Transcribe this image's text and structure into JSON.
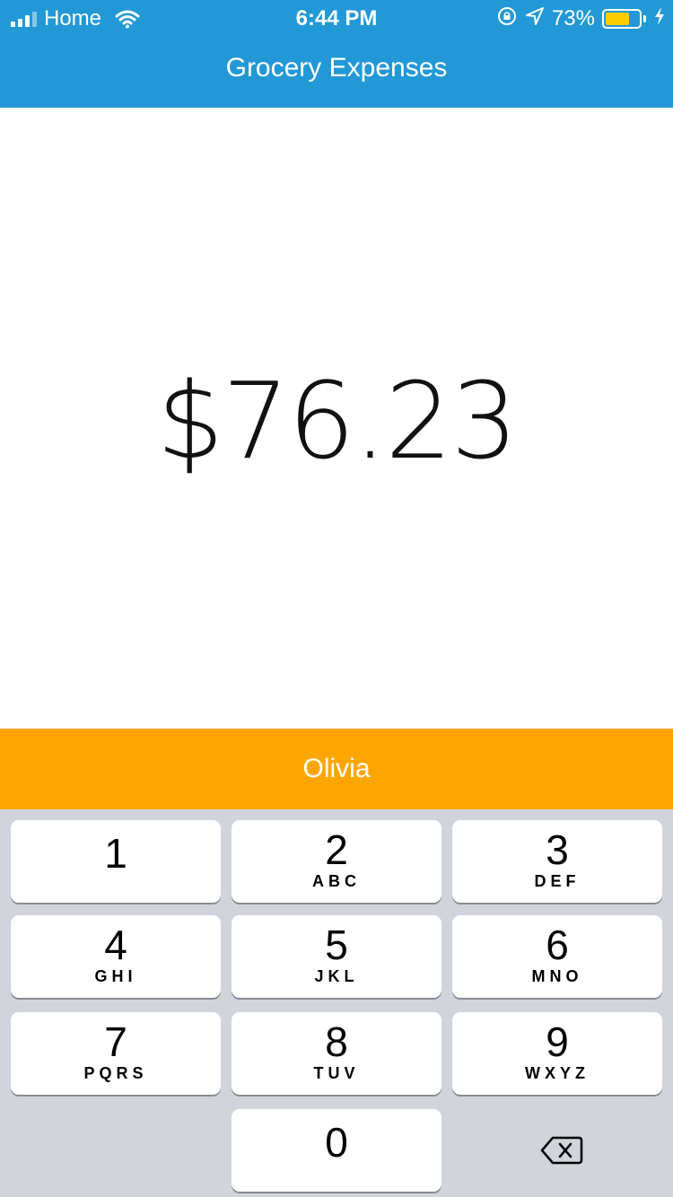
{
  "status_bar": {
    "carrier": "Home",
    "time": "6:44 PM",
    "battery_percent": "73%",
    "battery_level": 0.73
  },
  "nav": {
    "title": "Grocery Expenses"
  },
  "amount": "$76.23",
  "person": "Olivia",
  "keypad": {
    "keys": [
      {
        "digit": "1",
        "letters": ""
      },
      {
        "digit": "2",
        "letters": "ABC"
      },
      {
        "digit": "3",
        "letters": "DEF"
      },
      {
        "digit": "4",
        "letters": "GHI"
      },
      {
        "digit": "5",
        "letters": "JKL"
      },
      {
        "digit": "6",
        "letters": "MNO"
      },
      {
        "digit": "7",
        "letters": "PQRS"
      },
      {
        "digit": "8",
        "letters": "TUV"
      },
      {
        "digit": "9",
        "letters": "WXYZ"
      },
      {
        "digit": "0",
        "letters": ""
      }
    ],
    "delete_icon": "backspace-icon"
  },
  "colors": {
    "nav_bar": "#2299d6",
    "person_bar": "#ffa500",
    "keypad_bg": "#d1d4da",
    "battery_fill": "#ffcc00"
  }
}
